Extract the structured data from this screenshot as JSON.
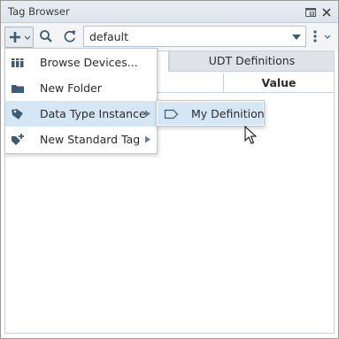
{
  "window": {
    "title": "Tag Browser",
    "float_icon": "float-window-icon",
    "close_icon": "close-icon"
  },
  "toolbar": {
    "add_icon": "plus-icon",
    "search_icon": "search-icon",
    "refresh_icon": "refresh-icon",
    "provider_value": "default",
    "more_icon": "vertical-dots-icon"
  },
  "tabs": [
    {
      "label": "",
      "active": true
    },
    {
      "label": "UDT Definitions",
      "active": false
    }
  ],
  "table": {
    "columns": [
      "",
      "Value"
    ]
  },
  "menu": {
    "items": [
      {
        "label": "Browse Devices...",
        "icon": "devices-icon",
        "has_submenu": false
      },
      {
        "label": "New Folder",
        "icon": "folder-icon",
        "has_submenu": false
      },
      {
        "label": "Data Type Instance",
        "icon": "tag-icon",
        "has_submenu": true,
        "highlighted": true
      },
      {
        "label": "New Standard Tag",
        "icon": "new-tag-icon",
        "has_submenu": true
      }
    ]
  },
  "submenu": {
    "items": [
      {
        "label": "My Definition",
        "icon": "udt-definition-icon"
      }
    ]
  },
  "colors": {
    "highlight": "#d5e6f5",
    "title_bar": "#e4eaf0"
  }
}
